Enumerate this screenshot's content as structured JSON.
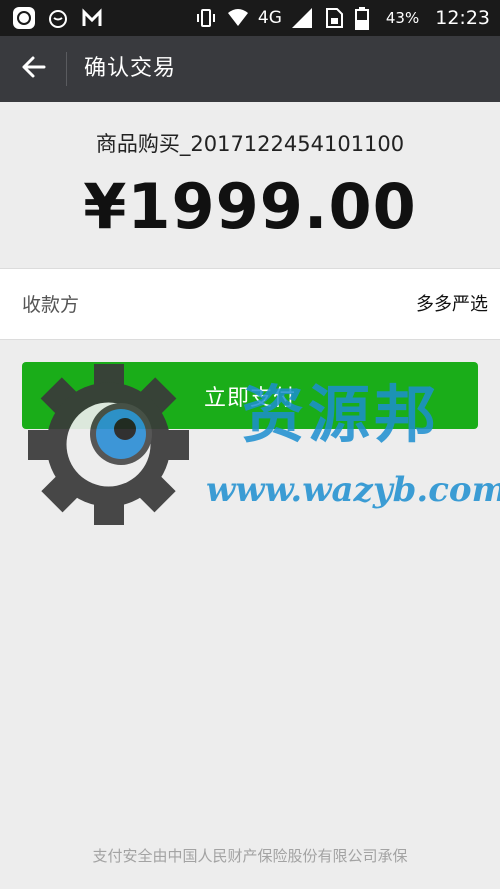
{
  "status_bar": {
    "network": "4G",
    "battery": "43%",
    "time": "12:23"
  },
  "header": {
    "title": "确认交易"
  },
  "order": {
    "product": "商品购买_2017122454101100",
    "amount": "¥1999.00"
  },
  "payee": {
    "label": "收款方",
    "value": "多多严选"
  },
  "pay_button": {
    "label": "立即支付"
  },
  "watermark": {
    "text": "资源邦",
    "url": "www.wazyb.com"
  },
  "footer": {
    "note": "支付安全由中国人民财产保险股份有限公司承保"
  },
  "colors": {
    "status_bar": "#1a1a1a",
    "app_bar": "#393a3e",
    "accent_green": "#1aad19",
    "watermark_blue": "#1d8fd0"
  }
}
